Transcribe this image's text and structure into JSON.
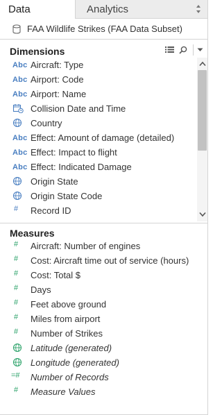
{
  "tabs": {
    "data_label": "Data",
    "analytics_label": "Analytics"
  },
  "datasource": {
    "name": "FAA Wildlife Strikes (FAA Data Subset)"
  },
  "dimensions": {
    "title": "Dimensions",
    "items": [
      {
        "icon": "abc",
        "label": "Aircraft: Type"
      },
      {
        "icon": "abc",
        "label": "Airport: Code"
      },
      {
        "icon": "abc",
        "label": "Airport: Name"
      },
      {
        "icon": "calendar",
        "label": "Collision Date and Time"
      },
      {
        "icon": "globe",
        "label": "Country"
      },
      {
        "icon": "abc",
        "label": "Effect: Amount of damage (detailed)"
      },
      {
        "icon": "abc",
        "label": "Effect: Impact to flight"
      },
      {
        "icon": "abc",
        "label": "Effect: Indicated Damage"
      },
      {
        "icon": "globe",
        "label": "Origin State"
      },
      {
        "icon": "globe",
        "label": "Origin State Code"
      },
      {
        "icon": "hash",
        "label": "Record ID"
      }
    ]
  },
  "measures": {
    "title": "Measures",
    "items": [
      {
        "icon": "hash",
        "label": "Aircraft: Number of engines"
      },
      {
        "icon": "hash",
        "label": "Cost: Aircraft time out of service (hours)"
      },
      {
        "icon": "hash",
        "label": "Cost: Total $"
      },
      {
        "icon": "hash",
        "label": "Days"
      },
      {
        "icon": "hash",
        "label": "Feet above ground"
      },
      {
        "icon": "hash",
        "label": "Miles from airport"
      },
      {
        "icon": "hash",
        "label": "Number of Strikes"
      },
      {
        "icon": "globe",
        "label": "Latitude (generated)"
      },
      {
        "icon": "globe",
        "label": "Longitude (generated)"
      },
      {
        "icon": "hash-calc",
        "label": "Number of Records"
      },
      {
        "icon": "hash",
        "label": "Measure Values"
      }
    ]
  },
  "colors": {
    "dimension_icon": "#4a7fc1",
    "measure_icon": "#2ea36b"
  }
}
